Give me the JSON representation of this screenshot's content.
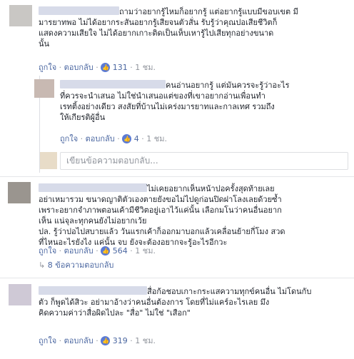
{
  "comments": [
    {
      "lines": [
        "ถามว่าอยากรู้ไหมก็อยากรู้ แต่อยากรู้แบบมีขอบเขต มี",
        "มารยาทพอ ไม่ได้อยากระสันอยากรู้เสียจนตัวสั่น รับรู้ว่าคุณปอเสียชีวิตก็",
        "แสดงความเสียใจ ไม่ได้อยากเกาะติดเป็นเห็บเหารู้ไปเสียทุกอย่างขนาด",
        "นั้น"
      ],
      "like": "ถูกใจ",
      "reply": "ตอบกลับ",
      "likes": "131",
      "time": "1 ชม."
    },
    {
      "lines": [
        "คนอ่านอยากรู้ แต่มันควรจะรู้ว่าอะไร",
        "ที่ควรจะนำเสนอ ไม่ใช่นำเสนอแต่ของที่เขาอยากอ่านเพื่อนทำ",
        "เรทติ้งอย่างเดียว สงสัยที่บ้านไม่เคร่งมารยาทและกาลเทศ รวมถึง",
        "ให้เกียรติผู้อื่น"
      ],
      "like": "ถูกใจ",
      "reply": "ตอบกลับ",
      "likes": "4",
      "time": "1 ชม."
    },
    {
      "lines": [
        "ไม่เคยอยากเห็นหน้าปอครั้งสุดท้ายเลย",
        "อย่าเหมารวม ขนาดญาติตัวเองตายยังขอไม่ไปดูก่อนปิดฝาโลงเลยด้วยซ้ำ",
        "เพราะอยากจำภาพตอนเค้ามีชีวิตอยู่เอาไว้แค่นั้น เลือกมโนว่าคนอื่นอยาก",
        "เห็น แน่จุละทุกคนยังไม่อยากเว้ย",
        "ปล. รู้ว่าปอไปสบายแล้ว วันแรกเค้าก็ออกมาบอกแล้วเคลื่อนย้ายกี่โมง สวด",
        "ที่ไหนอะไรยังไง แค่นั้น จบ ยังจะต้องอยากจะรู้อะไรอีกวะ"
      ],
      "like": "ถูกใจ",
      "reply": "ตอบกลับ",
      "likes": "564",
      "time": "1 ชม."
    },
    {
      "lines": [
        "สื่อก้อชอบเกาะกระแสความทุกข์คนอื่น ไม่โดนกับ",
        "ตัว ก็พูดได้สิวะ อย่ามาอ้างว่าคนอื่นต้องการ โดยที่ไม่แคร์อะไรเลย มึง",
        "คิดความค่าว่าสื่อผิดไปละ \"สื่อ\" ไม่ใช่ \"เสือก\""
      ],
      "like": "ถูกใจ",
      "reply": "ตอบกลับ",
      "likes": "319",
      "time": "1 ชม."
    }
  ],
  "reply_placeholder": "เขียนข้อความตอบกลับ...",
  "more_replies": "8 ข้อความตอบกลับ",
  "sep": "·",
  "colors": {
    "link": "#4b67a1",
    "meta": "#90949c",
    "thumb": "#5b7bd5",
    "divider": "#e5e6e9"
  }
}
